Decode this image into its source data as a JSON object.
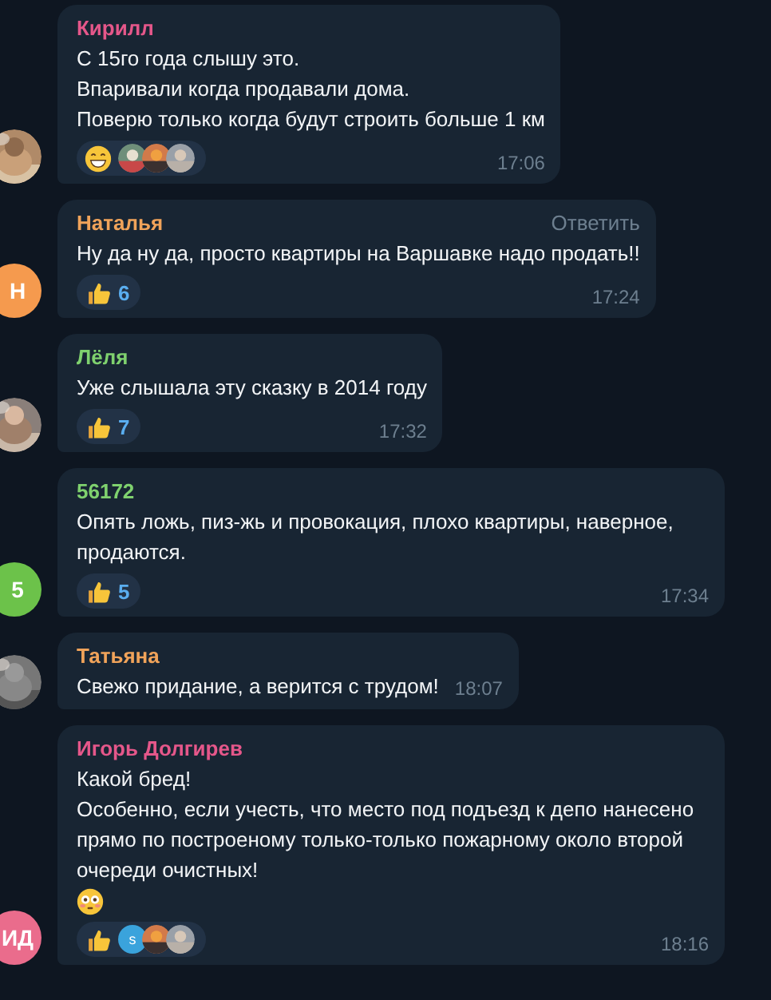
{
  "messages": [
    {
      "author": "Кирилл",
      "color": "#e5578a",
      "avatar": {
        "kind": "picture"
      },
      "lines": [
        "С 15го года слышу это.",
        "Впаривали когда продавали дома.",
        "Поверю только когда будут строить больше 1 км"
      ],
      "reaction": {
        "kind": "grin",
        "reactors": [
          {
            "kind": "picture"
          },
          {
            "kind": "picture"
          },
          {
            "kind": "picture"
          }
        ]
      },
      "time": "17:06"
    },
    {
      "author": "Наталья",
      "color": "#f0a35a",
      "reply_label": "Ответить",
      "avatar": {
        "kind": "initials",
        "text": "Н",
        "color": "#f59a4e"
      },
      "lines": [
        "Ну да ну да, просто квартиры на Варшавке надо продать!!"
      ],
      "reaction": {
        "kind": "thumbsup",
        "count": "6"
      },
      "time": "17:24"
    },
    {
      "author": "Лёля",
      "color": "#7fd16e",
      "avatar": {
        "kind": "picture"
      },
      "lines": [
        "Уже слышала эту сказку в 2014 году"
      ],
      "reaction": {
        "kind": "thumbsup",
        "count": "7"
      },
      "time": "17:32"
    },
    {
      "author": "56172",
      "color": "#7fd16e",
      "avatar": {
        "kind": "initials",
        "text": "5",
        "color": "#6cc24a"
      },
      "lines": [
        "Опять ложь, пиз-жь и провокация, плохо квартиры, наверное, продаются."
      ],
      "reaction": {
        "kind": "thumbsup",
        "count": "5"
      },
      "time": "17:34"
    },
    {
      "author": "Татьяна",
      "color": "#f0a35a",
      "avatar": {
        "kind": "picture"
      },
      "lines": [
        "Свежо придание, а верится с трудом!"
      ],
      "time": "18:07"
    },
    {
      "author": "Игорь Долгирев",
      "color": "#e5578a",
      "avatar": {
        "kind": "initials",
        "text": "ИД",
        "color": "#ea6c8c"
      },
      "lines": [
        "Какой бред!",
        "Особенно, если учесть, что место под подъезд к депо нанесено прямо по построеному только-только пожарному около второй очереди очистных!"
      ],
      "trailing_emoji": {
        "kind": "flushed"
      },
      "reaction": {
        "kind": "thumbsup",
        "reactors": [
          {
            "kind": "initials",
            "text": "s",
            "color": "#3aa3dc"
          },
          {
            "kind": "picture"
          },
          {
            "kind": "picture"
          }
        ]
      },
      "time": "18:16"
    }
  ]
}
